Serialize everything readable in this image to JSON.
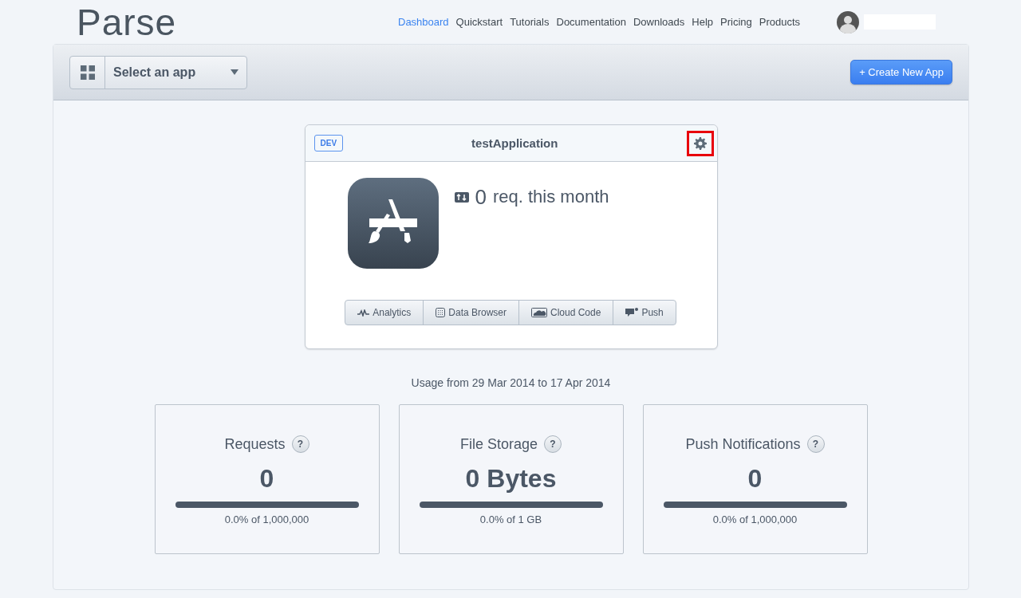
{
  "logo": "Parse",
  "nav": [
    {
      "label": "Dashboard",
      "selected": true
    },
    {
      "label": "Quickstart",
      "selected": false
    },
    {
      "label": "Tutorials",
      "selected": false
    },
    {
      "label": "Documentation",
      "selected": false
    },
    {
      "label": "Downloads",
      "selected": false
    },
    {
      "label": "Help",
      "selected": false
    },
    {
      "label": "Pricing",
      "selected": false
    },
    {
      "label": "Products",
      "selected": false
    }
  ],
  "toolbar": {
    "app_select": "Select an app",
    "create_button": "+ Create New App"
  },
  "app_card": {
    "badge": "DEV",
    "name": "testApplication",
    "settings_highlighted": true,
    "requests_count": "0",
    "requests_label": "req. this month",
    "actions": [
      {
        "kind": "analytics",
        "label": "Analytics"
      },
      {
        "kind": "data",
        "label": "Data Browser"
      },
      {
        "kind": "cloud",
        "label": "Cloud Code"
      },
      {
        "kind": "push",
        "label": "Push"
      }
    ]
  },
  "usage_period": "Usage from 29 Mar 2014 to 17 Apr 2014",
  "stats": [
    {
      "title": "Requests",
      "help": "?",
      "value": "0",
      "level": 0,
      "caption": "0.0% of 1,000,000"
    },
    {
      "title": "File Storage",
      "help": "?",
      "value": "0 Bytes",
      "level": 0,
      "caption": "0.0% of 1 GB"
    },
    {
      "title": "Push Notifications",
      "help": "?",
      "value": "0",
      "level": 0,
      "caption": "0.0% of 1,000,000"
    }
  ]
}
